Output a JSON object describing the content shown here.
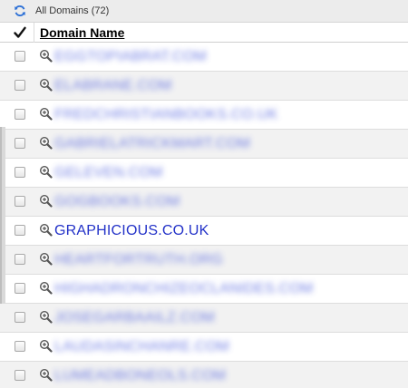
{
  "toolbar": {
    "icon": "refresh-icon",
    "title": "All Domains (72)"
  },
  "table": {
    "header": {
      "select_all_icon": "checkmark-icon",
      "column_label": "Domain Name"
    },
    "rows": [
      {
        "domain": "EGGTOPIABRAT.COM",
        "obscured": true
      },
      {
        "domain": "ELABRANE.COM",
        "obscured": true
      },
      {
        "domain": "FREDCHRISTIANBOOKS.CO.UK",
        "obscured": true
      },
      {
        "domain": "GABRIELATRICKMART.COM",
        "obscured": true
      },
      {
        "domain": "GELEVEN.COM",
        "obscured": true
      },
      {
        "domain": "GOGBOOKS.COM",
        "obscured": true
      },
      {
        "domain": "GRAPHICIOUS.CO.UK",
        "obscured": false
      },
      {
        "domain": "HEARTFORTRUTH.ORG",
        "obscured": true
      },
      {
        "domain": "HIGHADRONCHIZEOCLANIDES.COM",
        "obscured": true
      },
      {
        "domain": "JOSEGARBAAILZ.COM",
        "obscured": true
      },
      {
        "domain": "LAUDASINCHANRE.COM",
        "obscured": true
      },
      {
        "domain": "LUMEADBONEOLS.COM",
        "obscured": true
      }
    ],
    "row_icon": "zoom-icon"
  },
  "colors": {
    "link": "#2332c8",
    "row_alt": "#f2f2f2",
    "toolbar_bg": "#ececec"
  }
}
